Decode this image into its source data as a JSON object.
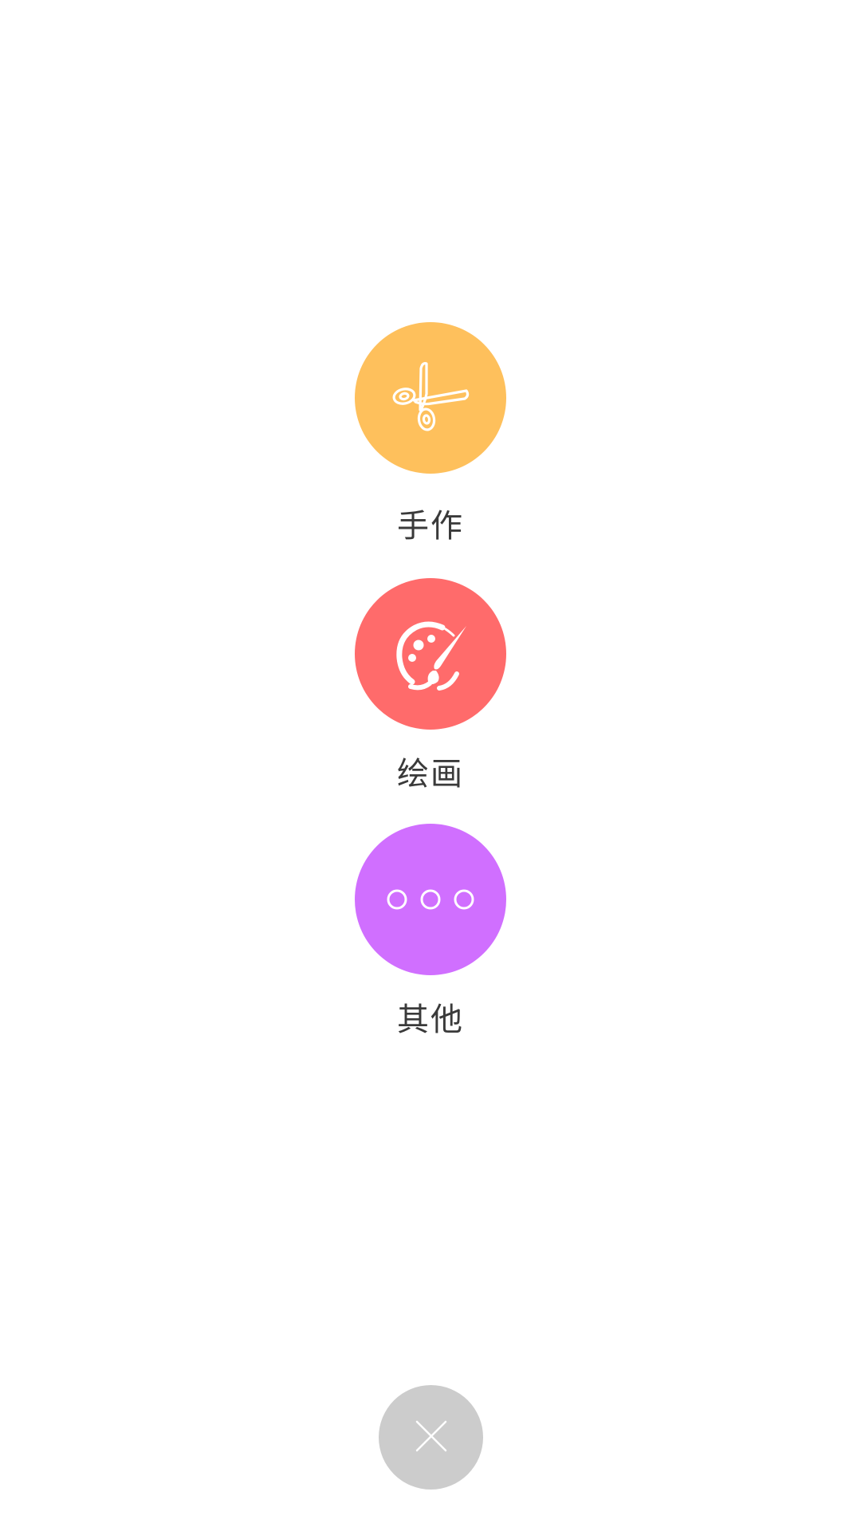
{
  "options": [
    {
      "id": "craft",
      "label": "手作",
      "icon": "scissors-icon",
      "color": "#FEC05C"
    },
    {
      "id": "paint",
      "label": "绘画",
      "icon": "palette-icon",
      "color": "#FF6B6B"
    },
    {
      "id": "other",
      "label": "其他",
      "icon": "more-icon",
      "color": "#D06FFF"
    }
  ],
  "close": {
    "icon": "close-icon",
    "color": "#CCCCCC"
  }
}
